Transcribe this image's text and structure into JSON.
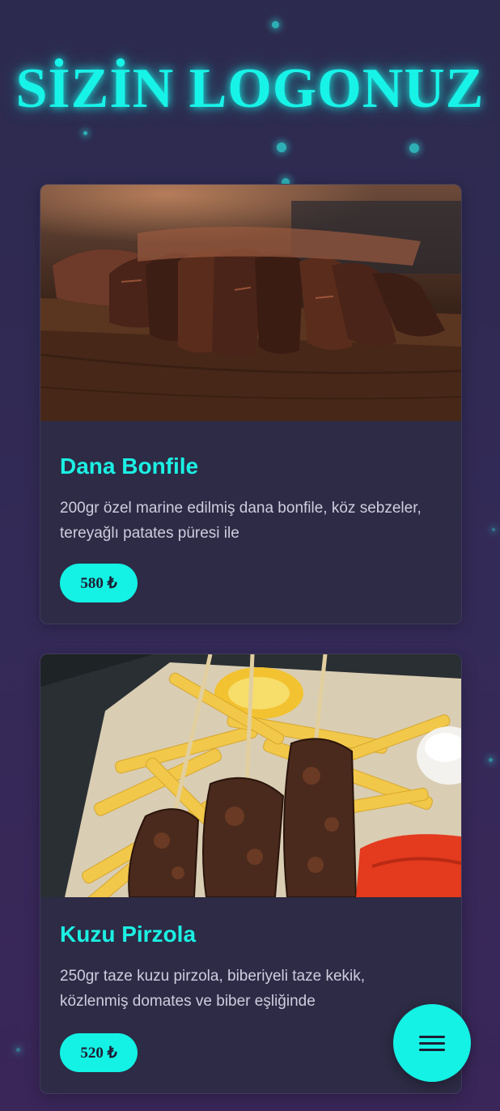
{
  "header": {
    "logo_text": "SİZİN LOGONUZ"
  },
  "menu_items": [
    {
      "name": "Dana Bonfile",
      "description": "200gr özel marine edilmiş dana bonfile, köz sebzeler, tereyağlı patates püresi ile",
      "price": "580 ₺",
      "image": "steak-photo"
    },
    {
      "name": "Kuzu Pirzola",
      "description": "250gr taze kuzu pirzola, biberiyeli taze kekik, közlenmiş domates ve biber eşliğinde",
      "price": "520 ₺",
      "image": "skewer-fries-photo"
    }
  ],
  "fab": {
    "icon": "menu-icon"
  },
  "colors": {
    "accent": "#13f2e4",
    "card": "#2d2b45",
    "background": "#2c2a4e"
  }
}
